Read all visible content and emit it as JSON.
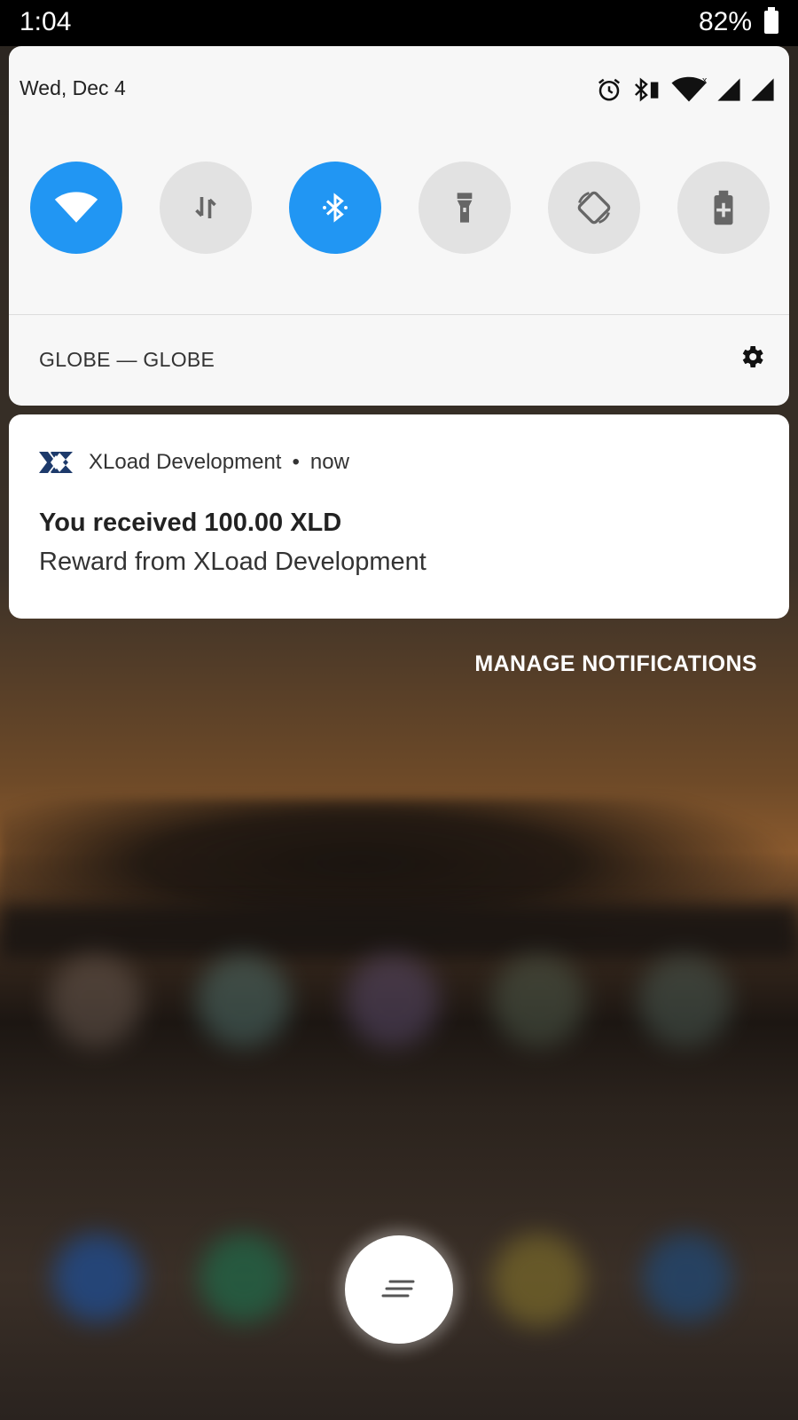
{
  "status_bar": {
    "time": "1:04",
    "battery_percent": "82%",
    "icons": [
      "battery-icon"
    ]
  },
  "quick_settings": {
    "date": "Wed, Dec 4",
    "status_icons": [
      "alarm-icon",
      "bluetooth-battery-icon",
      "wifi-icon",
      "signal-icon",
      "signal-icon"
    ],
    "wifi_network_indicator": "x",
    "tiles": [
      {
        "name": "wifi",
        "icon": "wifi-icon",
        "active": true
      },
      {
        "name": "mobile-data",
        "icon": "data-transfer-icon",
        "active": false
      },
      {
        "name": "bluetooth",
        "icon": "bluetooth-icon",
        "active": true
      },
      {
        "name": "flashlight",
        "icon": "flashlight-icon",
        "active": false
      },
      {
        "name": "auto-rotate",
        "icon": "rotate-icon",
        "active": false
      },
      {
        "name": "battery-saver",
        "icon": "battery-saver-icon",
        "active": false
      }
    ],
    "carrier": "GLOBE — GLOBE",
    "active_color": "#2196f3",
    "inactive_color": "#e2e2e2"
  },
  "notification": {
    "app_name": "XLoad Development",
    "separator": "•",
    "time": "now",
    "title": "You received 100.00 XLD",
    "body": "Reward from XLoad Development",
    "app_icon": "xload-logo-icon",
    "brand_color": "#1d3a6b"
  },
  "manage_label": "MANAGE NOTIFICATIONS",
  "fab": {
    "icon": "notes-icon"
  }
}
